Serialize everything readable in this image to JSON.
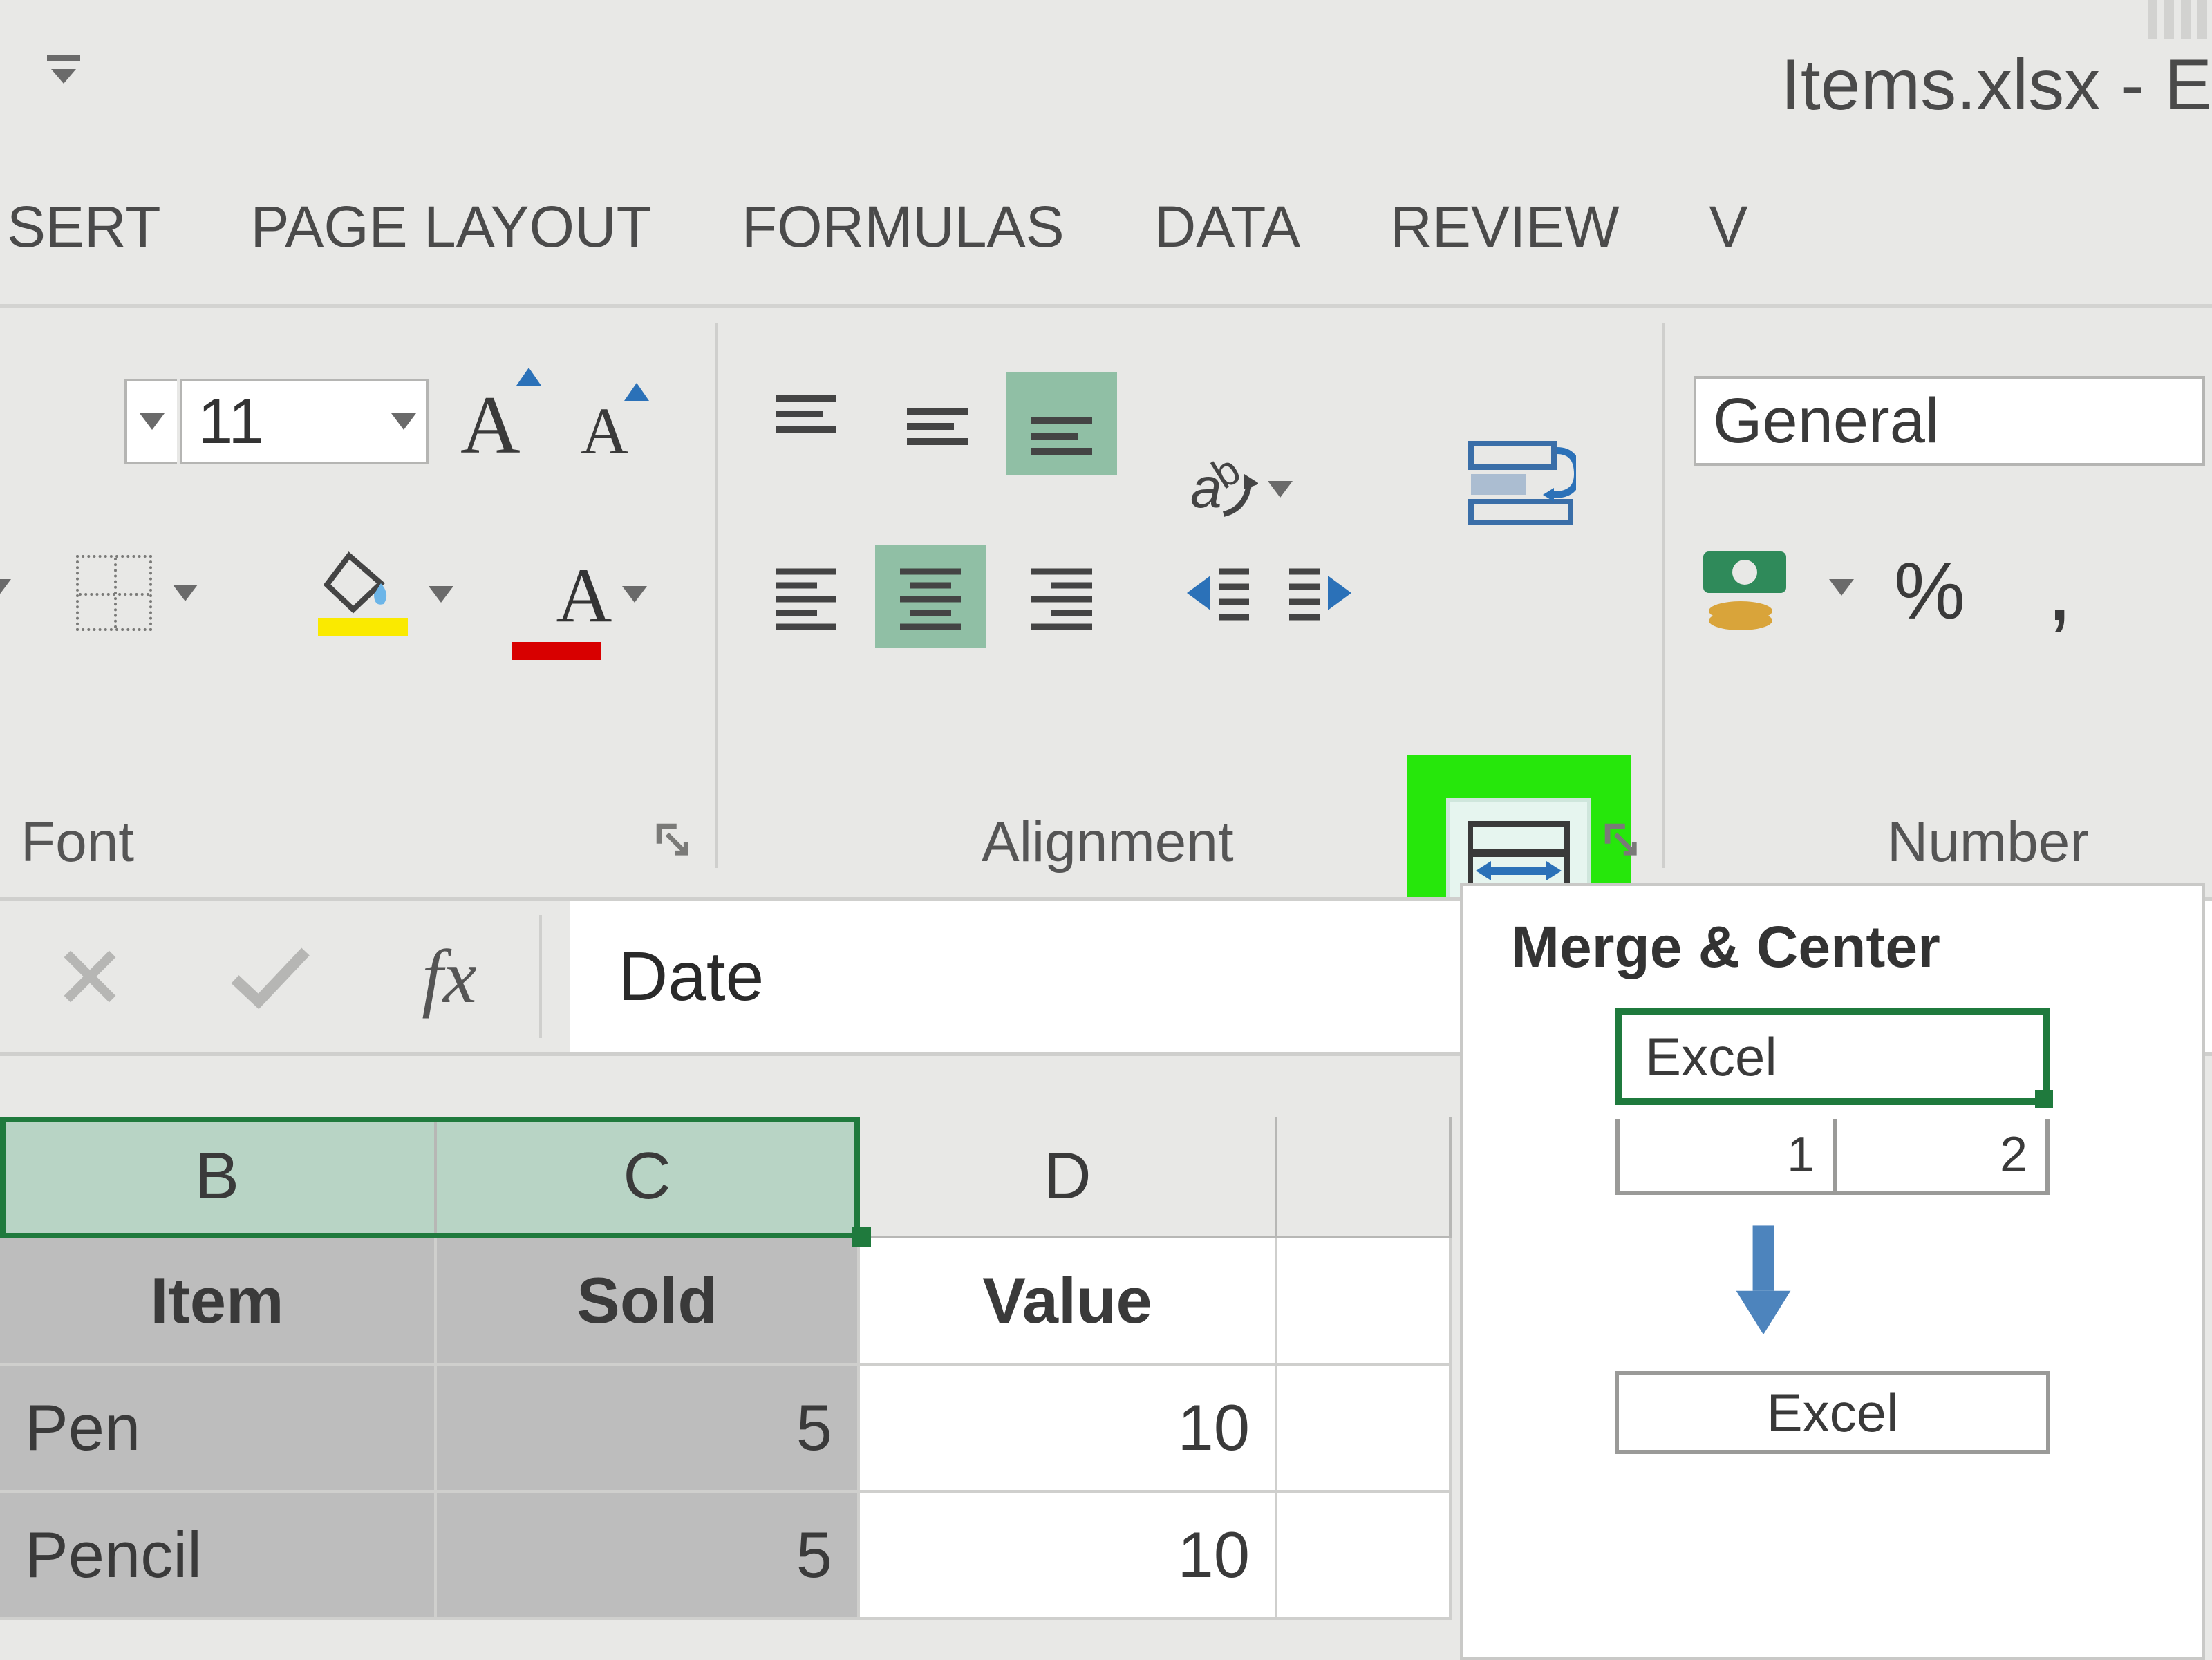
{
  "titlebar": {
    "filename": "Items.xlsx - E"
  },
  "ribbon_tabs": {
    "insert": "SERT",
    "page_layout": "PAGE LAYOUT",
    "formulas": "FORMULAS",
    "data": "DATA",
    "review": "REVIEW",
    "view_partial": "V"
  },
  "font_group": {
    "size": "11",
    "label": "Font",
    "grow_font_glyph": "A",
    "shrink_font_glyph": "A"
  },
  "alignment_group": {
    "label": "Alignment"
  },
  "number_group": {
    "format": "General",
    "label": "Number",
    "percent_glyph": "%",
    "comma_glyph": ","
  },
  "formula_bar": {
    "value": "Date",
    "fx_glyph": "fx"
  },
  "columns": {
    "b": "B",
    "c": "C",
    "d": "D"
  },
  "table": {
    "headers": {
      "item": "Item",
      "sold": "Sold",
      "value": "Value"
    },
    "rows": [
      {
        "item": "Pen",
        "sold": "5",
        "value": "10"
      },
      {
        "item": "Pencil",
        "sold": "5",
        "value": "10"
      }
    ]
  },
  "tooltip": {
    "title": "Merge & Center",
    "sample_text": "Excel",
    "sample_1": "1",
    "sample_2": "2",
    "result_text": "Excel"
  }
}
